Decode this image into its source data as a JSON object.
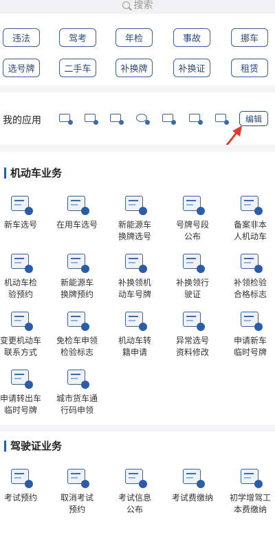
{
  "search": {
    "placeholder": "搜索"
  },
  "quick_chips": [
    "违法",
    "驾考",
    "年检",
    "事故",
    "挪车",
    "选号牌",
    "二手车",
    "补换牌",
    "补换证",
    "租赁"
  ],
  "my_apps": {
    "title": "我的应用",
    "icons": [
      "car-icon",
      "document-icon",
      "form-icon",
      "chat-icon",
      "license-plate-icon",
      "list-icon",
      "id-card-icon"
    ],
    "edit_label": "编辑"
  },
  "vehicle_section": {
    "title": "机动车业务",
    "items": [
      "新车选号",
      "在用车选号",
      "新能源车\n换牌选号",
      "号牌号段\n公布",
      "备案非本\n人机动车",
      "机动车检\n验预约",
      "新能源车\n换牌预约",
      "补换领机\n动车号牌",
      "补换领行\n驶证",
      "补领检验\n合格标志",
      "变更机动车\n联系方式",
      "免检车申领\n检验标志",
      "机动车转\n籍申请",
      "异常选号\n资料修改",
      "申请新车\n临时号牌",
      "申请转出车\n临时号牌",
      "城市货车通\n行码申领"
    ]
  },
  "license_section": {
    "title": "驾驶证业务",
    "items": [
      "考试预约",
      "取消考试\n预约",
      "考试信息\n公布",
      "考试费缴纳",
      "初学增驾工\n本费缴纳"
    ]
  },
  "colors": {
    "accent": "#2a5ca8",
    "outline": "#3a5f94",
    "arrow": "#e23b2e"
  }
}
